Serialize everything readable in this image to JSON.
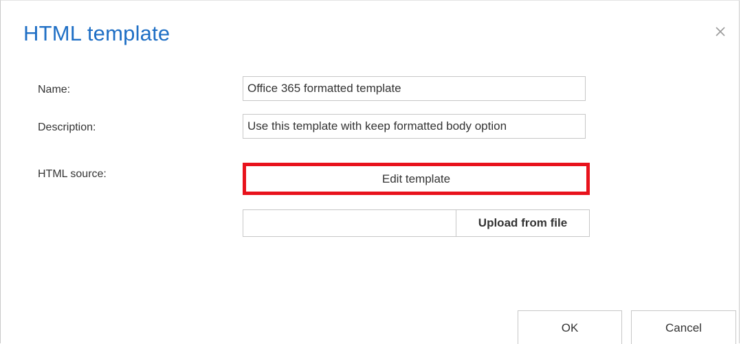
{
  "dialog": {
    "title": "HTML template",
    "close_icon": "close-icon"
  },
  "form": {
    "name_label": "Name:",
    "name_value": "Office 365 formatted template",
    "description_label": "Description:",
    "description_value": "Use this template with keep formatted body option",
    "html_source_label": "HTML source:",
    "edit_template_label": "Edit template",
    "upload_path_value": "",
    "upload_label": "Upload from file"
  },
  "footer": {
    "ok_label": "OK",
    "cancel_label": "Cancel"
  },
  "colors": {
    "title": "#1f6fc5",
    "highlight": "#e8121c",
    "border": "#c6c6c6"
  }
}
